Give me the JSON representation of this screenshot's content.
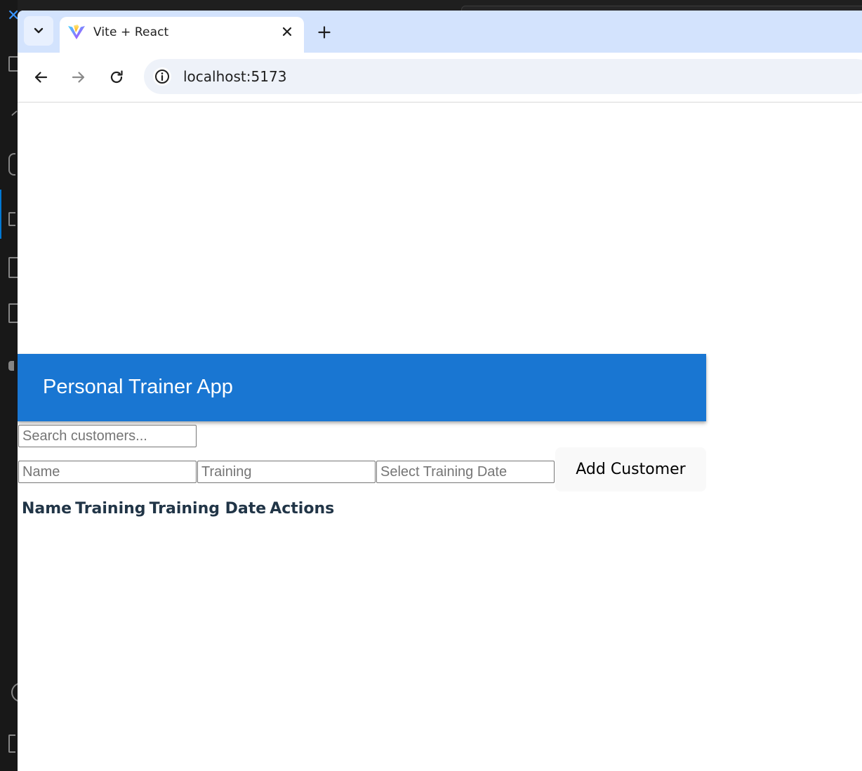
{
  "browser": {
    "tab": {
      "title": "Vite + React"
    },
    "url": "localhost:5173"
  },
  "app": {
    "title": "Personal Trainer App",
    "search": {
      "placeholder": "Search customers...",
      "value": ""
    },
    "form": {
      "name_placeholder": "Name",
      "training_placeholder": "Training",
      "date_placeholder": "Select Training Date",
      "add_button": "Add Customer"
    },
    "table": {
      "columns": [
        "Name",
        "Training",
        "Training Date",
        "Actions"
      ]
    }
  },
  "colors": {
    "appbar": "#1976d2",
    "tab_strip": "#d3e3fd",
    "header_text": "#213547"
  }
}
